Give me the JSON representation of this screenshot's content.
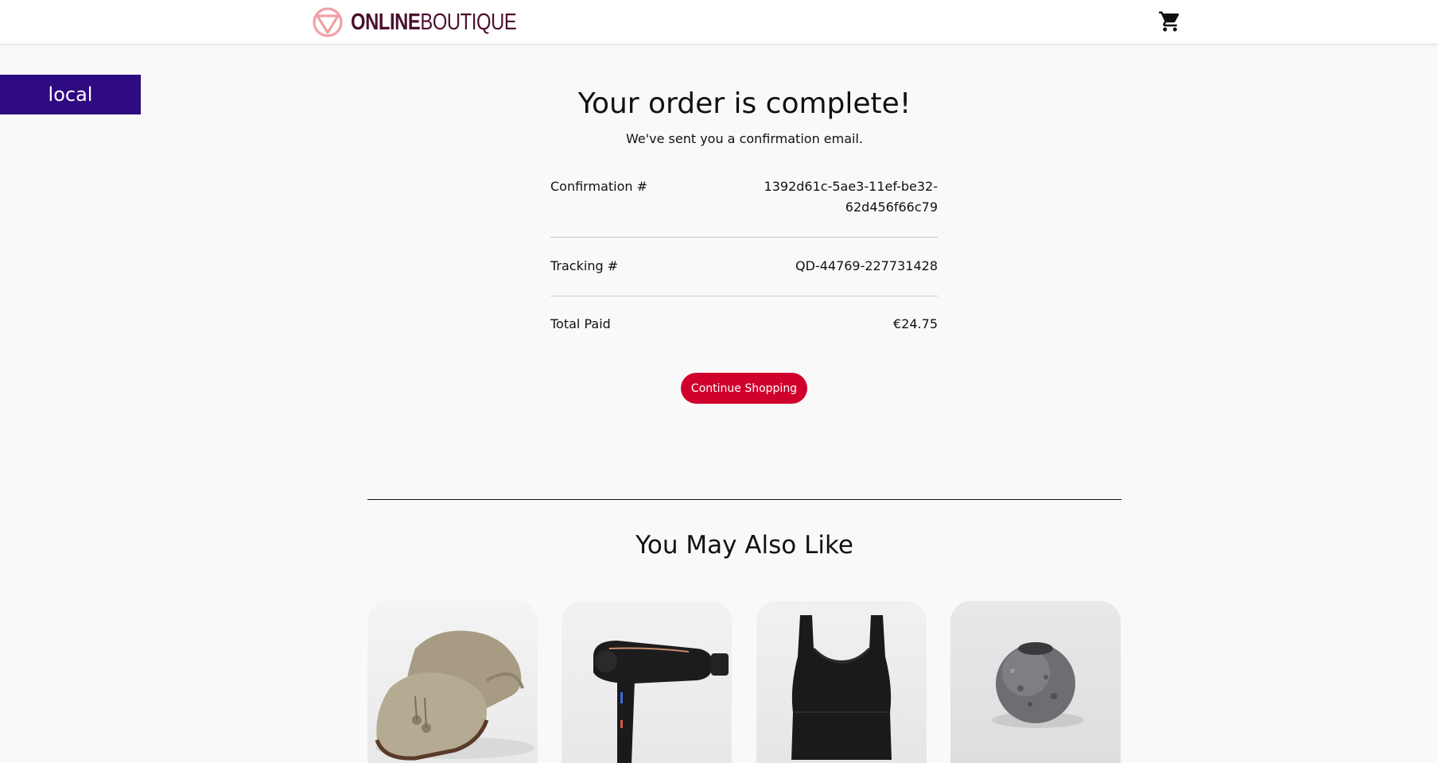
{
  "header": {
    "logo_bold": "ONLINE",
    "logo_light": "BOUTIQUE",
    "cart_icon": "cart-icon"
  },
  "env_tag": "local",
  "order": {
    "title": "Your order is complete!",
    "subtitle": "We've sent you a confirmation email.",
    "confirmation_label": "Confirmation #",
    "confirmation_value": "1392d61c-5ae3-11ef-be32-62d456f66c79",
    "tracking_label": "Tracking #",
    "tracking_value": "QD-44769-227731428",
    "total_label": "Total Paid",
    "total_value": "€24.75",
    "continue_label": "Continue Shopping"
  },
  "recommendations": {
    "title": "You May Also Like",
    "items": [
      {
        "image": "loafers"
      },
      {
        "image": "hairdryer"
      },
      {
        "image": "tank-top"
      },
      {
        "image": "candle-holder"
      }
    ]
  },
  "colors": {
    "accent": "#d0002c",
    "brand": "#4b0f2d",
    "env_tag": "#2f0b82",
    "background": "#f9f9f9"
  }
}
